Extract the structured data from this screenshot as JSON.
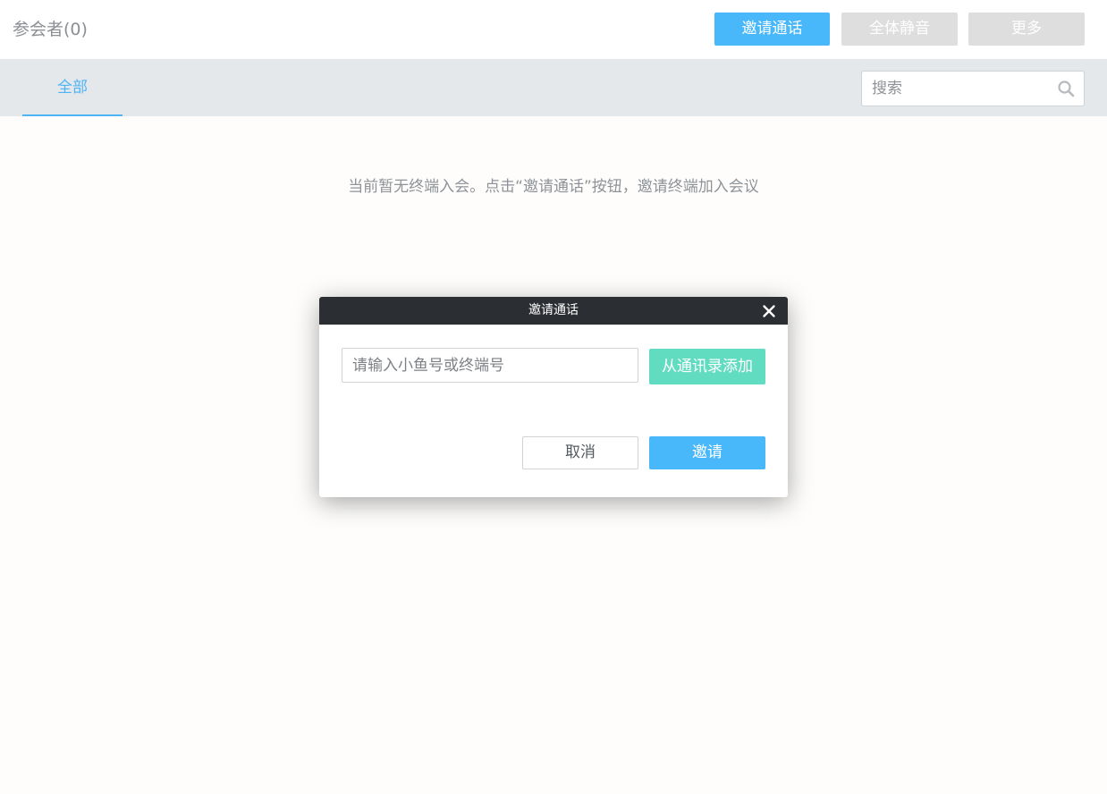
{
  "header": {
    "title": "参会者(0)",
    "invite_call_label": "邀请通话",
    "mute_all_label": "全体静音",
    "more_label": "更多"
  },
  "tabs": [
    {
      "label": "全部",
      "active": true
    }
  ],
  "search": {
    "placeholder": "搜索",
    "value": "",
    "icon": "search-icon"
  },
  "empty_hint": "当前暂无终端入会。点击“邀请通话”按钮，邀请终端加入会议",
  "dialog": {
    "title": "邀请通话",
    "close_icon": "close-icon",
    "input_placeholder": "请输入小鱼号或终端号",
    "input_value": "",
    "add_from_contacts_label": "从通讯录添加",
    "cancel_label": "取消",
    "invite_label": "邀请"
  },
  "colors": {
    "primary": "#49b8fa",
    "contacts_button": "#62dcc1",
    "disabled_button": "#dedede",
    "dialog_header": "#2b2e33",
    "tabbar_bg": "#e4e8eb"
  }
}
